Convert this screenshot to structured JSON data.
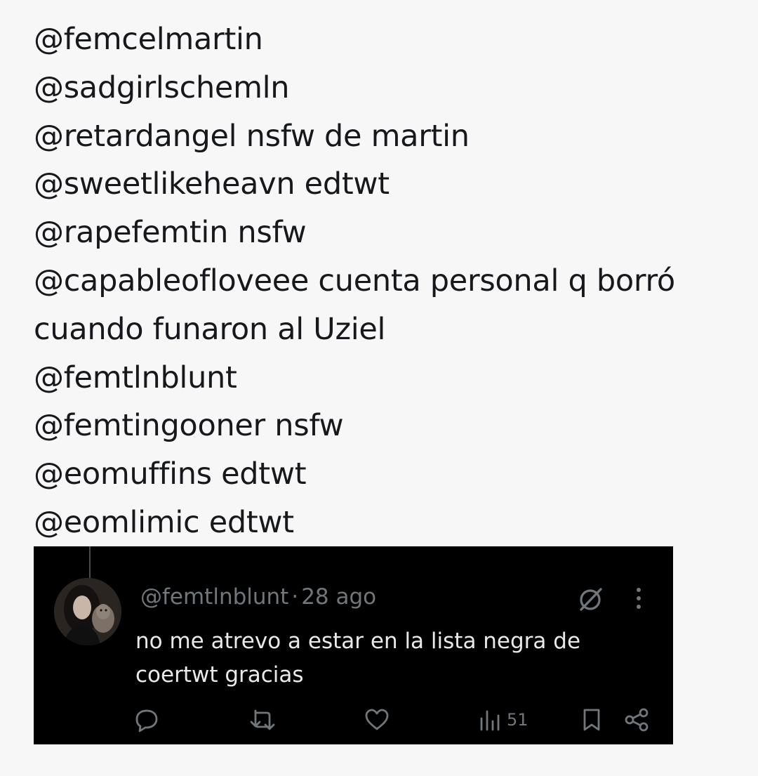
{
  "list": {
    "lines": [
      "@femcelmartin",
      "@sadgirlschemln",
      "@retardangel nsfw de martin",
      "@sweetlikeheavn edtwt",
      "@rapefemtin nsfw",
      "@capableofloveee cuenta personal q borró",
      "cuando funaron al Uziel",
      "@femtlnblunt",
      "@femtingooner nsfw",
      "@eomuffins edtwt",
      "@eomlimic edtwt"
    ]
  },
  "tweet": {
    "handle": "@femtlnblunt",
    "separator": "·",
    "date": "28 ago",
    "text_line1": "no me atrevo a estar en la lista negra de",
    "text_line2": "coertwt gracias",
    "views": "51",
    "icons": {
      "avatar": "profile-photo",
      "grok": "grok-icon",
      "more": "more-vertical-icon",
      "reply": "reply-icon",
      "retweet": "retweet-icon",
      "like": "heart-icon",
      "views": "views-bar-chart-icon",
      "bookmark": "bookmark-icon",
      "share": "share-icon"
    }
  },
  "colors": {
    "page_background": "#f7f7f7",
    "list_text": "#16181c",
    "embed_background": "#000000",
    "tweet_text": "#e7e9ea",
    "muted_text": "#71767b"
  }
}
